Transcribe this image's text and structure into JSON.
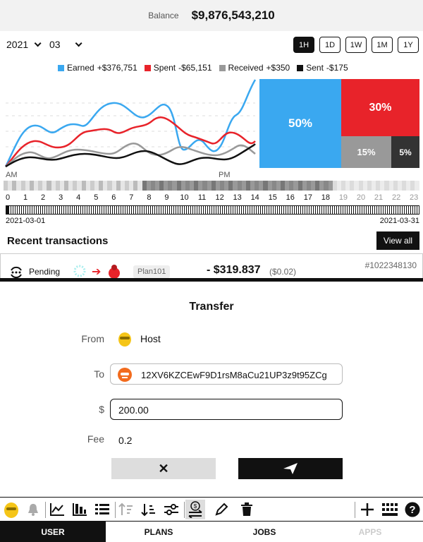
{
  "balance": {
    "label": "Balance",
    "value": "$9,876,543,210"
  },
  "filters": {
    "year": "2021",
    "month": "03"
  },
  "ranges": [
    "1H",
    "1D",
    "1W",
    "1M",
    "1Y"
  ],
  "active_range": "1H",
  "legend": [
    {
      "label": "Earned",
      "amount": "+$376,751",
      "color": "#3aa8f0"
    },
    {
      "label": "Spent",
      "amount": "-$65,151",
      "color": "#e8232a"
    },
    {
      "label": "Received",
      "amount": "+$350",
      "color": "#999999"
    },
    {
      "label": "Sent",
      "amount": "-$175",
      "color": "#111111"
    }
  ],
  "treemap": [
    "50%",
    "30%",
    "15%",
    "5%"
  ],
  "ampm": {
    "am": "AM",
    "pm": "PM"
  },
  "hours": [
    "0",
    "1",
    "2",
    "3",
    "4",
    "5",
    "6",
    "7",
    "8",
    "9",
    "10",
    "11",
    "12",
    "13",
    "14",
    "15",
    "16",
    "17",
    "18",
    "19",
    "20",
    "21",
    "22",
    "23"
  ],
  "date_range": {
    "start": "2021-03-01",
    "end": "2021-03-31"
  },
  "recent": {
    "title": "Recent transactions",
    "view_all": "View all"
  },
  "transaction": {
    "status": "Pending",
    "plan": "Plan101",
    "amount": "- $319.837",
    "fee": "($0.02)",
    "id": "#1022348130"
  },
  "transfer": {
    "title": "Transfer",
    "from_label": "From",
    "from_value": "Host",
    "to_label": "To",
    "to_value": "12XV6KZCEwF9D1rsM8aCu21UP3z9t95ZCg",
    "amount_label": "$",
    "amount_value": "200.00",
    "fee_label": "Fee",
    "fee_value": "0.2"
  },
  "toolbar_icons": [
    "avatar",
    "bell-icon",
    "line-chart-icon",
    "bar-chart-icon",
    "list-icon",
    "sort-asc-icon",
    "sort-desc-icon",
    "sliders-icon",
    "transfer-icon",
    "pencil-icon",
    "trash-icon",
    "plus-icon",
    "keyboard-icon",
    "help-icon"
  ],
  "tabs": [
    "USER",
    "PLANS",
    "JOBS",
    "APPS"
  ],
  "active_tab": "USER"
}
